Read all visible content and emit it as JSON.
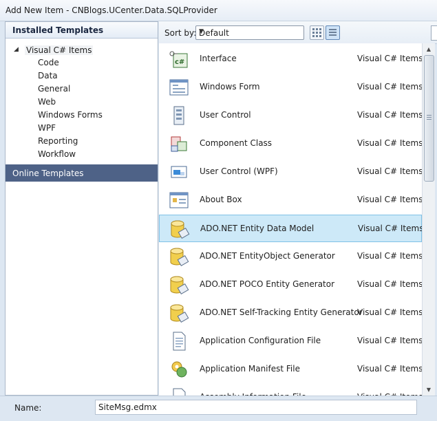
{
  "window": {
    "title": "Add New Item - CNBlogs.UCenter.Data.SQLProvider"
  },
  "left_panel": {
    "header": "Installed Templates",
    "tree_root": "Visual C# Items",
    "tree_items": [
      "Code",
      "Data",
      "General",
      "Web",
      "Windows Forms",
      "WPF",
      "Reporting",
      "Workflow"
    ],
    "online_templates": "Online Templates"
  },
  "toolbar": {
    "sort_label": "Sort by:",
    "sort_value": "Default"
  },
  "templates": [
    {
      "name": "Interface",
      "category": "Visual C# Items",
      "icon": "interface-icon"
    },
    {
      "name": "Windows Form",
      "category": "Visual C# Items",
      "icon": "windows-form-icon"
    },
    {
      "name": "User Control",
      "category": "Visual C# Items",
      "icon": "user-control-icon"
    },
    {
      "name": "Component Class",
      "category": "Visual C# Items",
      "icon": "component-class-icon"
    },
    {
      "name": "User Control (WPF)",
      "category": "Visual C# Items",
      "icon": "wpf-user-control-icon"
    },
    {
      "name": "About Box",
      "category": "Visual C# Items",
      "icon": "about-box-icon"
    },
    {
      "name": "ADO.NET Entity Data Model",
      "category": "Visual C# Items",
      "icon": "database-icon",
      "selected": true
    },
    {
      "name": "ADO.NET EntityObject Generator",
      "category": "Visual C# Items",
      "icon": "database-icon"
    },
    {
      "name": "ADO.NET POCO Entity Generator",
      "category": "Visual C# Items",
      "icon": "database-icon"
    },
    {
      "name": "ADO.NET Self-Tracking Entity Generator",
      "category": "Visual C# Items",
      "icon": "database-icon"
    },
    {
      "name": "Application Configuration File",
      "category": "Visual C# Items",
      "icon": "config-file-icon"
    },
    {
      "name": "Application Manifest File",
      "category": "Visual C# Items",
      "icon": "manifest-file-icon"
    },
    {
      "name": "Assembly Information File",
      "category": "Visual C# Items",
      "icon": "assembly-info-icon"
    }
  ],
  "bottom": {
    "name_label": "Name:",
    "name_value": "SiteMsg.edmx"
  },
  "colors": {
    "selection": "#cde9f8",
    "online_bg": "#4e6287"
  }
}
